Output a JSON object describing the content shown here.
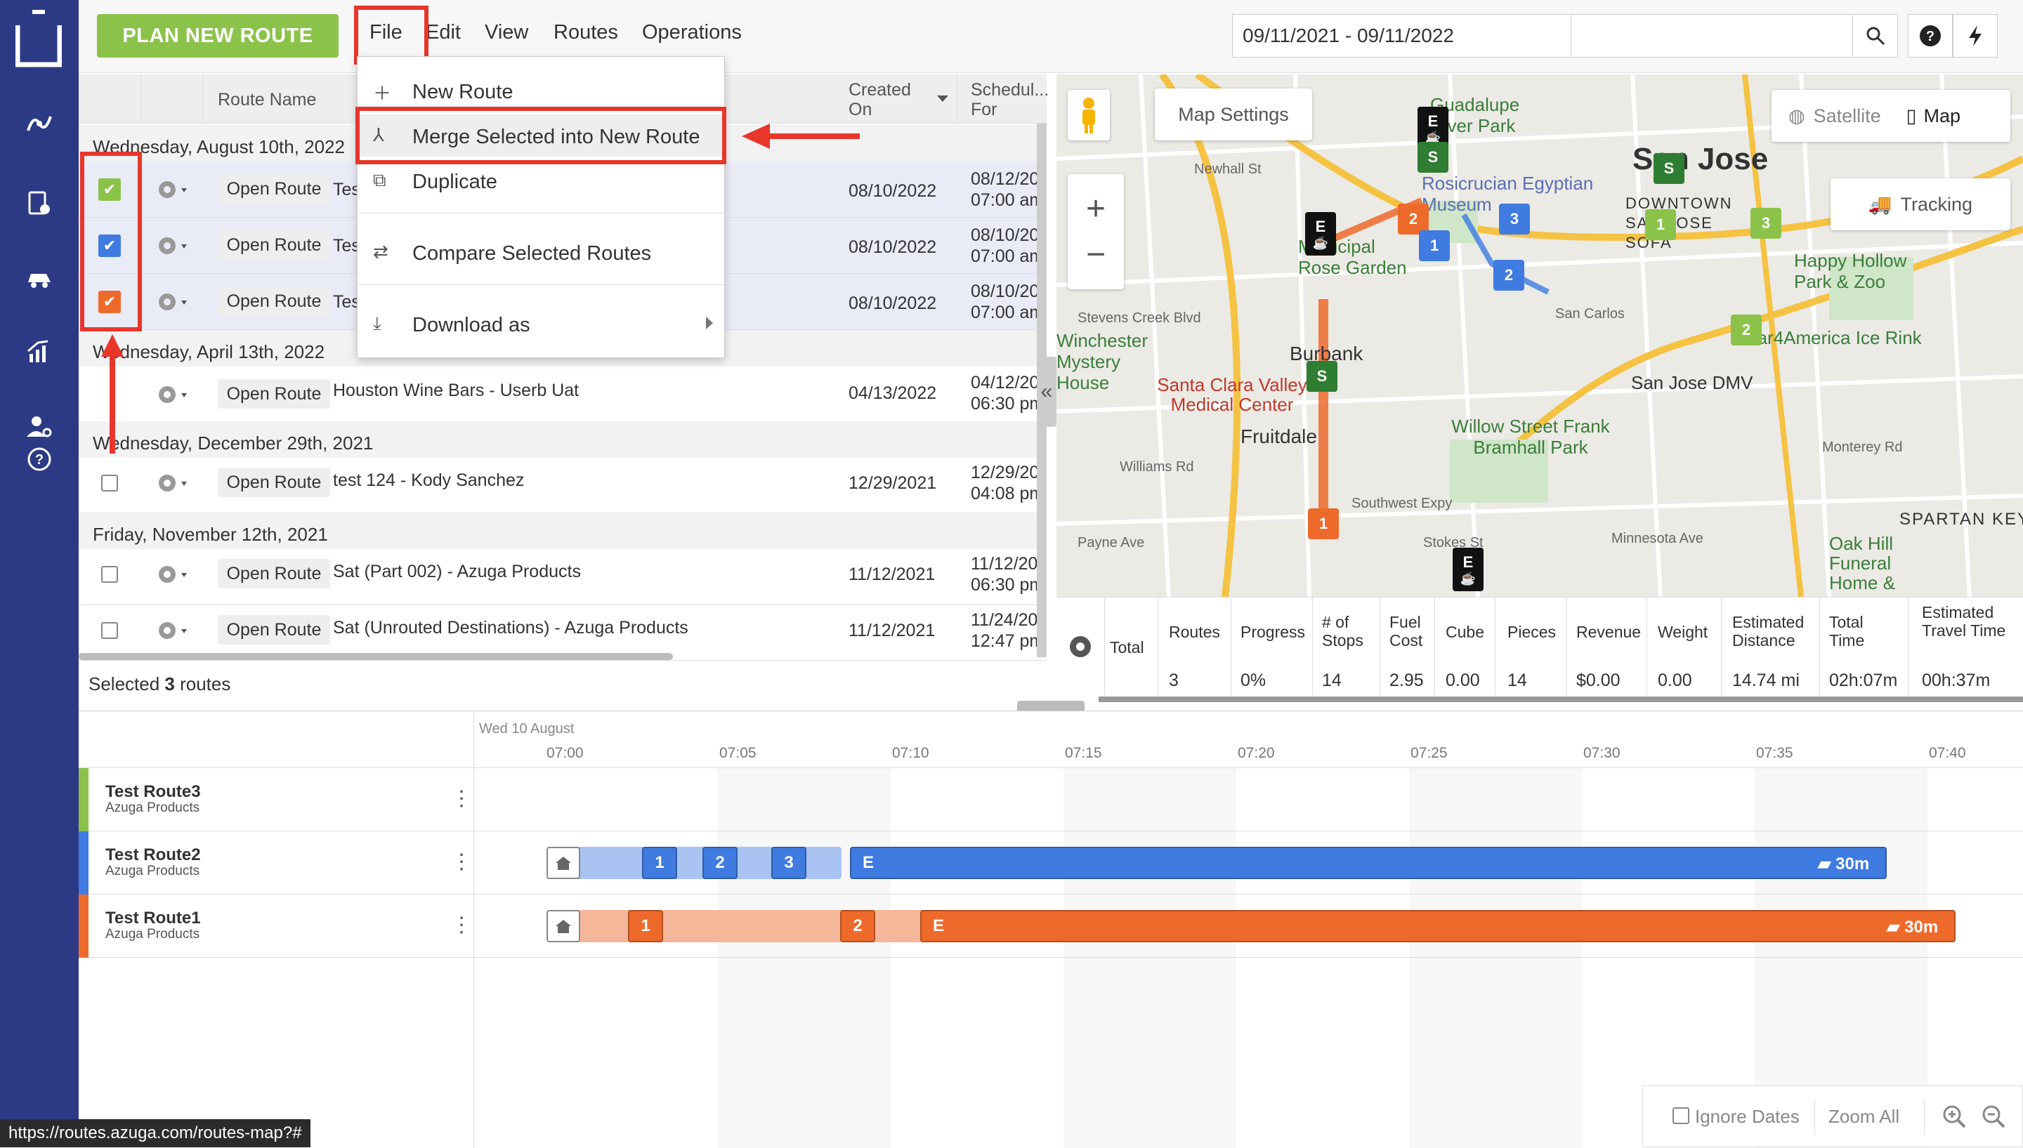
{
  "topbar": {
    "plan_button": "PLAN NEW ROUTE",
    "menus": [
      "File",
      "Edit",
      "View",
      "Routes",
      "Operations"
    ],
    "date_range": "09/11/2021 - 09/11/2022",
    "search_placeholder": ""
  },
  "file_menu": {
    "items": [
      {
        "label": "New Route",
        "icon": "plus-icon"
      },
      {
        "label": "Merge Selected into New Route",
        "icon": "merge-icon"
      },
      {
        "label": "Duplicate",
        "icon": "duplicate-icon"
      },
      {
        "label": "Compare Selected Routes",
        "icon": "compare-icon"
      },
      {
        "label": "Download as",
        "icon": "download-icon"
      }
    ]
  },
  "routes_table": {
    "headers": {
      "name": "Route Name",
      "created": "Created On",
      "scheduled": "Schedul... For"
    },
    "groups": [
      {
        "label": "Wednesday, August 10th, 2022"
      },
      {
        "label": "Wednesday, April 13th, 2022"
      },
      {
        "label": "Wednesday, December 29th, 2021"
      },
      {
        "label": "Friday, November 12th, 2021"
      }
    ],
    "open_label": "Open Route",
    "rows": [
      {
        "name": "Tes",
        "created": "08/10/2022",
        "sched1": "08/12/20",
        "sched2": "07:00 am",
        "checked": true,
        "color": "#8bc34a"
      },
      {
        "name": "Tes",
        "created": "08/10/2022",
        "sched1": "08/10/20",
        "sched2": "07:00 am",
        "checked": true,
        "color": "#3f7be0"
      },
      {
        "name": "Tes",
        "created": "08/10/2022",
        "sched1": "08/10/20",
        "sched2": "07:00 am",
        "checked": true,
        "color": "#ee6a2b"
      },
      {
        "name": "Houston Wine Bars - Userb Uat",
        "created": "04/13/2022",
        "sched1": "04/12/20",
        "sched2": "06:30 pm",
        "checked": false
      },
      {
        "name": "test 124 - Kody Sanchez",
        "created": "12/29/2021",
        "sched1": "12/29/20",
        "sched2": "04:08 pm",
        "checked": false
      },
      {
        "name": "Sat (Part 002) - Azuga Products",
        "created": "11/12/2021",
        "sched1": "11/12/20",
        "sched2": "06:30 pm",
        "checked": false
      },
      {
        "name": "Sat (Unrouted Destinations) - Azuga Products",
        "created": "11/12/2021",
        "sched1": "11/24/20",
        "sched2": "12:47 pm",
        "checked": false
      }
    ],
    "selected_prefix": "Selected ",
    "selected_count": "3",
    "selected_suffix": " routes"
  },
  "map": {
    "settings_label": "Map Settings",
    "satellite_label": "Satellite",
    "map_label": "Map",
    "tracking_label": "Tracking",
    "places": [
      "San Jose",
      "Guadalupe River Park",
      "Rosicrucian Egyptian Museum",
      "Municipal Rose Garden",
      "DOWNTOWN SAN JOSE SOFA",
      "Happy Hollow Park & Zoo",
      "Solar4America Ice Rink",
      "San Jose DMV",
      "Willow Street Frank Bramhall Park",
      "Santa Clara Valley Medical Center",
      "Fruitdale",
      "Burbank",
      "Winchester Mystery House",
      "SPARTAN KEYE",
      "Oak Hill Funeral Home &",
      "San Carlos",
      "Newhall St",
      "Stevens Creek Blvd",
      "Williams Rd",
      "Payne Ave",
      "Minnesota Ave",
      "Stokes St",
      "Monterey Rd",
      "Southwest Expy"
    ]
  },
  "stats": {
    "gear_icon": "gear-icon",
    "headers": [
      "Total",
      "Routes",
      "Progress",
      "# of Stops",
      "Fuel Cost",
      "Cube",
      "Pieces",
      "Revenue",
      "Weight",
      "Estimated Distance",
      "Total Time",
      "Estimated Travel Time"
    ],
    "values": [
      "",
      "3",
      "0%",
      "14",
      "2.95",
      "0.00",
      "14",
      "$0.00",
      "0.00",
      "14.74 mi",
      "02h:07m",
      "00h:37m"
    ]
  },
  "timeline": {
    "date": "Wed 10 August",
    "ticks": [
      "07:00",
      "07:05",
      "07:10",
      "07:15",
      "07:20",
      "07:25",
      "07:30",
      "07:35",
      "07:40"
    ],
    "routes": [
      {
        "name": "Test Route3",
        "org": "Azuga Products",
        "color": "#8bc34a"
      },
      {
        "name": "Test Route2",
        "org": "Azuga Products",
        "color": "#3f7be0"
      },
      {
        "name": "Test Route1",
        "org": "Azuga Products",
        "color": "#ee6a2b"
      }
    ],
    "route2_stops": [
      "1",
      "2",
      "3",
      "E"
    ],
    "route1_stops": [
      "1",
      "2",
      "E"
    ],
    "break_label": "30m",
    "ignore_dates": "Ignore Dates",
    "zoom_all": "Zoom All"
  },
  "status_url": "https://routes.azuga.com/routes-map?#",
  "colors": {
    "sidebar": "#2c3a86",
    "accent_green": "#8bc34a",
    "route_blue": "#3f7be0",
    "route_orange": "#ee6a2b",
    "highlight": "#e8362b"
  }
}
